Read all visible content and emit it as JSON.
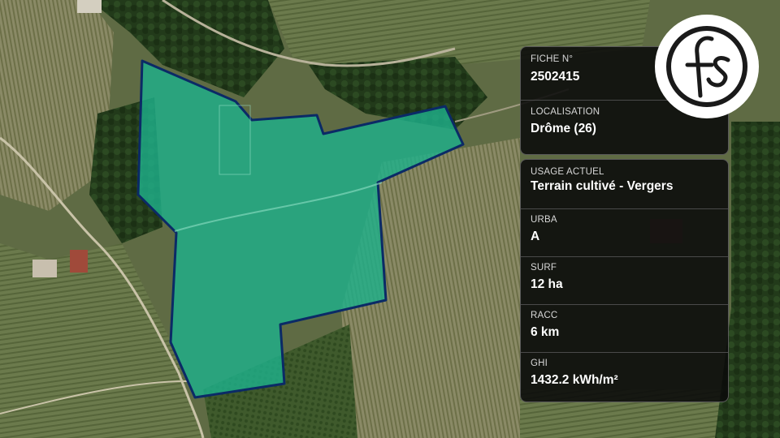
{
  "map": {
    "parcel_fill": "#1fb08a",
    "parcel_stroke": "#0b2a66"
  },
  "card_top": {
    "fiche": {
      "label": "FICHE N°",
      "value": "2502415"
    },
    "localisation": {
      "label": "LOCALISATION",
      "value": "Drôme (26)"
    }
  },
  "card_bottom": {
    "usage": {
      "label": "USAGE ACTUEL",
      "value": "Terrain cultivé - Vergers"
    },
    "urba": {
      "label": "URBA",
      "value": "A"
    },
    "surf": {
      "label": "SURF",
      "value": "12 ha"
    },
    "racc": {
      "label": "RACC",
      "value": "6 km"
    },
    "ghi": {
      "label": "GHI",
      "value": "1432.2 kWh/m²"
    }
  },
  "logo": {
    "icon": "fs-monogram-logo"
  }
}
